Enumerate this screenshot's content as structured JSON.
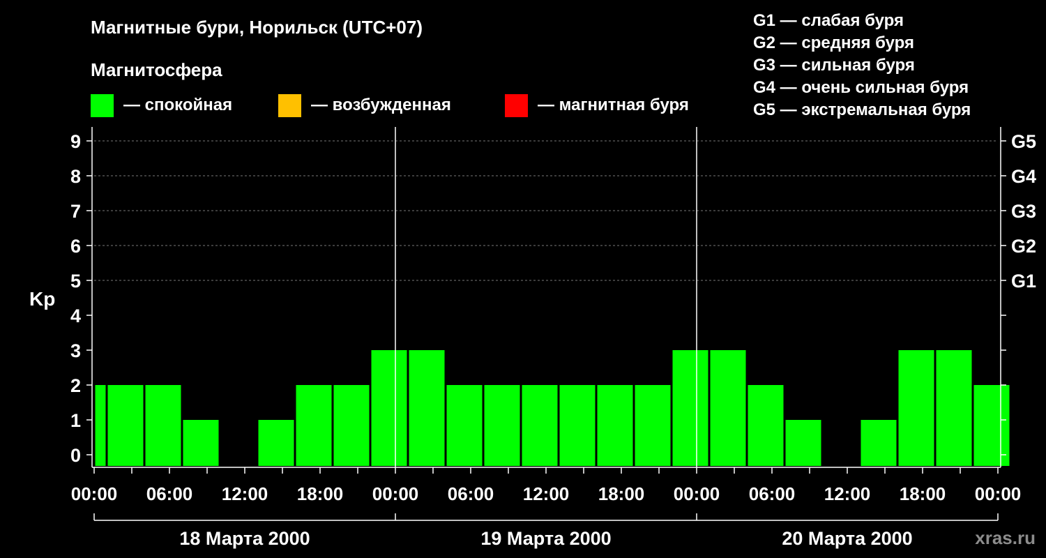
{
  "chart_data": {
    "type": "bar",
    "title": "Магнитные бури, Норильск (UTC+07)",
    "legend_title": "Магнитосфера",
    "legend": [
      {
        "label": "— спокойная",
        "color": "#00ff00"
      },
      {
        "label": "— возбужденная",
        "color": "#ffc000"
      },
      {
        "label": "— магнитная буря",
        "color": "#ff0000"
      }
    ],
    "g_scale": [
      "G1 — слабая буря",
      "G2 — средняя буря",
      "G3 — сильная буря",
      "G4 — очень сильная буря",
      "G5 — экстремальная буря"
    ],
    "ylabel": "Kp",
    "ylim": [
      0,
      9
    ],
    "yticks": [
      "0",
      "1",
      "2",
      "3",
      "4",
      "5",
      "6",
      "7",
      "8",
      "9"
    ],
    "right_ticks": [
      {
        "kp": 5,
        "label": "G1"
      },
      {
        "kp": 6,
        "label": "G2"
      },
      {
        "kp": 7,
        "label": "G3"
      },
      {
        "kp": 8,
        "label": "G4"
      },
      {
        "kp": 9,
        "label": "G5"
      }
    ],
    "xticks": [
      "00:00",
      "06:00",
      "12:00",
      "18:00",
      "00:00",
      "06:00",
      "12:00",
      "18:00",
      "00:00",
      "06:00",
      "12:00",
      "18:00",
      "00:00"
    ],
    "days": [
      "18 Марта 2000",
      "19 Марта 2000",
      "20 Марта 2000"
    ],
    "bar_hours": 3,
    "first_bar_hours": 1,
    "values": [
      2,
      2,
      2,
      1,
      0,
      1,
      2,
      2,
      3,
      3,
      2,
      2,
      2,
      2,
      2,
      2,
      3,
      3,
      2,
      1,
      0,
      1,
      3,
      3,
      2
    ],
    "grid": "dashed at Kp 5–9",
    "bar_color": "#00ff00"
  },
  "watermark": "xras.ru"
}
